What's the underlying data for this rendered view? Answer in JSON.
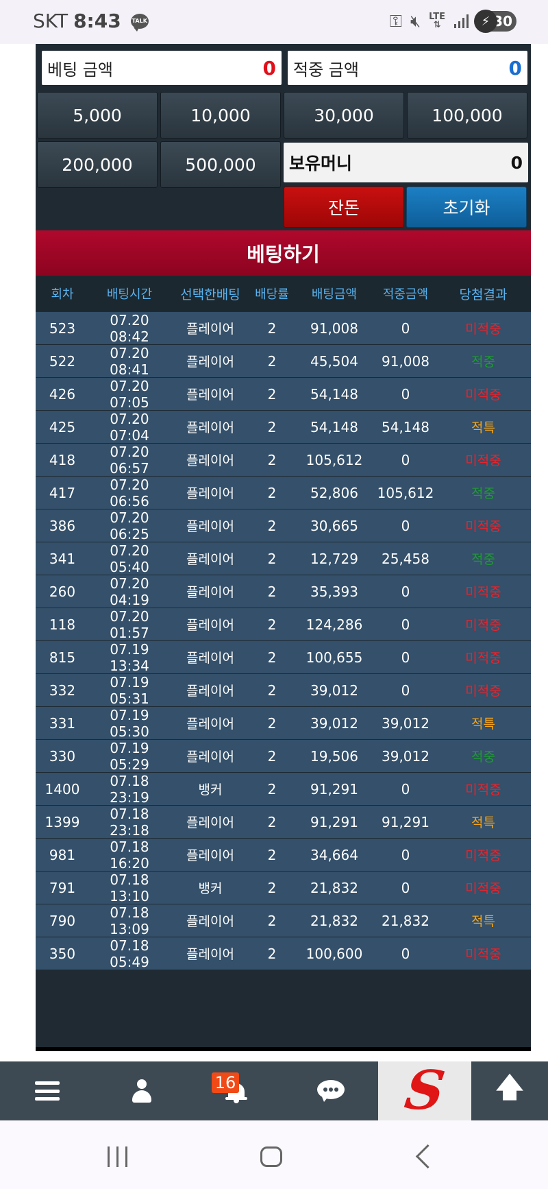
{
  "status_bar": {
    "carrier": "SKT",
    "time": "8:43",
    "talk_icon_text": "TALK",
    "lte": "LTE",
    "battery": "30"
  },
  "bet_panel": {
    "bet_amount_label": "베팅 금액",
    "bet_amount_value": "0",
    "win_amount_label": "적중 금액",
    "win_amount_value": "0",
    "chips": [
      "5,000",
      "10,000",
      "30,000",
      "100,000",
      "200,000",
      "500,000"
    ],
    "money_label": "보유머니",
    "money_value": "0",
    "half_label": "잔돈",
    "reset_label": "초기화",
    "bet_button_label": "베팅하기",
    "colors": {
      "red_value": "#e0111b",
      "blue_value": "#1a6fd1"
    }
  },
  "table": {
    "headers": [
      "회차",
      "배팅시간",
      "선택한배팅",
      "배당률",
      "배팅금액",
      "적중금액",
      "당첨결과"
    ],
    "rows": [
      {
        "round": "523",
        "time": "07.20 08:42",
        "pick": "플레이어",
        "odds": "2",
        "bet": "91,008",
        "win": "0",
        "result": "미적중",
        "kind": "lose"
      },
      {
        "round": "522",
        "time": "07.20 08:41",
        "pick": "플레이어",
        "odds": "2",
        "bet": "45,504",
        "win": "91,008",
        "result": "적중",
        "kind": "win"
      },
      {
        "round": "426",
        "time": "07.20 07:05",
        "pick": "플레이어",
        "odds": "2",
        "bet": "54,148",
        "win": "0",
        "result": "미적중",
        "kind": "lose"
      },
      {
        "round": "425",
        "time": "07.20 07:04",
        "pick": "플레이어",
        "odds": "2",
        "bet": "54,148",
        "win": "54,148",
        "result": "적특",
        "kind": "special"
      },
      {
        "round": "418",
        "time": "07.20 06:57",
        "pick": "플레이어",
        "odds": "2",
        "bet": "105,612",
        "win": "0",
        "result": "미적중",
        "kind": "lose"
      },
      {
        "round": "417",
        "time": "07.20 06:56",
        "pick": "플레이어",
        "odds": "2",
        "bet": "52,806",
        "win": "105,612",
        "result": "적중",
        "kind": "win"
      },
      {
        "round": "386",
        "time": "07.20 06:25",
        "pick": "플레이어",
        "odds": "2",
        "bet": "30,665",
        "win": "0",
        "result": "미적중",
        "kind": "lose"
      },
      {
        "round": "341",
        "time": "07.20 05:40",
        "pick": "플레이어",
        "odds": "2",
        "bet": "12,729",
        "win": "25,458",
        "result": "적중",
        "kind": "win"
      },
      {
        "round": "260",
        "time": "07.20 04:19",
        "pick": "플레이어",
        "odds": "2",
        "bet": "35,393",
        "win": "0",
        "result": "미적중",
        "kind": "lose"
      },
      {
        "round": "118",
        "time": "07.20 01:57",
        "pick": "플레이어",
        "odds": "2",
        "bet": "124,286",
        "win": "0",
        "result": "미적중",
        "kind": "lose"
      },
      {
        "round": "815",
        "time": "07.19 13:34",
        "pick": "플레이어",
        "odds": "2",
        "bet": "100,655",
        "win": "0",
        "result": "미적중",
        "kind": "lose"
      },
      {
        "round": "332",
        "time": "07.19 05:31",
        "pick": "플레이어",
        "odds": "2",
        "bet": "39,012",
        "win": "0",
        "result": "미적중",
        "kind": "lose"
      },
      {
        "round": "331",
        "time": "07.19 05:30",
        "pick": "플레이어",
        "odds": "2",
        "bet": "39,012",
        "win": "39,012",
        "result": "적특",
        "kind": "special"
      },
      {
        "round": "330",
        "time": "07.19 05:29",
        "pick": "플레이어",
        "odds": "2",
        "bet": "19,506",
        "win": "39,012",
        "result": "적중",
        "kind": "win"
      },
      {
        "round": "1400",
        "time": "07.18 23:19",
        "pick": "뱅커",
        "odds": "2",
        "bet": "91,291",
        "win": "0",
        "result": "미적중",
        "kind": "lose"
      },
      {
        "round": "1399",
        "time": "07.18 23:18",
        "pick": "플레이어",
        "odds": "2",
        "bet": "91,291",
        "win": "91,291",
        "result": "적특",
        "kind": "special"
      },
      {
        "round": "981",
        "time": "07.18 16:20",
        "pick": "플레이어",
        "odds": "2",
        "bet": "34,664",
        "win": "0",
        "result": "미적중",
        "kind": "lose"
      },
      {
        "round": "791",
        "time": "07.18 13:10",
        "pick": "뱅커",
        "odds": "2",
        "bet": "21,832",
        "win": "0",
        "result": "미적중",
        "kind": "lose"
      },
      {
        "round": "790",
        "time": "07.18 13:09",
        "pick": "플레이어",
        "odds": "2",
        "bet": "21,832",
        "win": "21,832",
        "result": "적특",
        "kind": "special"
      },
      {
        "round": "350",
        "time": "07.18 05:49",
        "pick": "플레이어",
        "odds": "2",
        "bet": "100,600",
        "win": "0",
        "result": "미적중",
        "kind": "lose"
      }
    ],
    "result_colors": {
      "lose": "#e8232c",
      "win": "#1f9a33",
      "special": "#f5a51c"
    }
  },
  "app_bar": {
    "notification_count": "16",
    "icons": [
      "menu-icon",
      "user-icon",
      "bell-icon",
      "chat-icon",
      "site-logo",
      "arrow-up-icon"
    ]
  },
  "system_nav": {
    "icons": [
      "recents-icon",
      "home-icon",
      "back-icon"
    ]
  }
}
